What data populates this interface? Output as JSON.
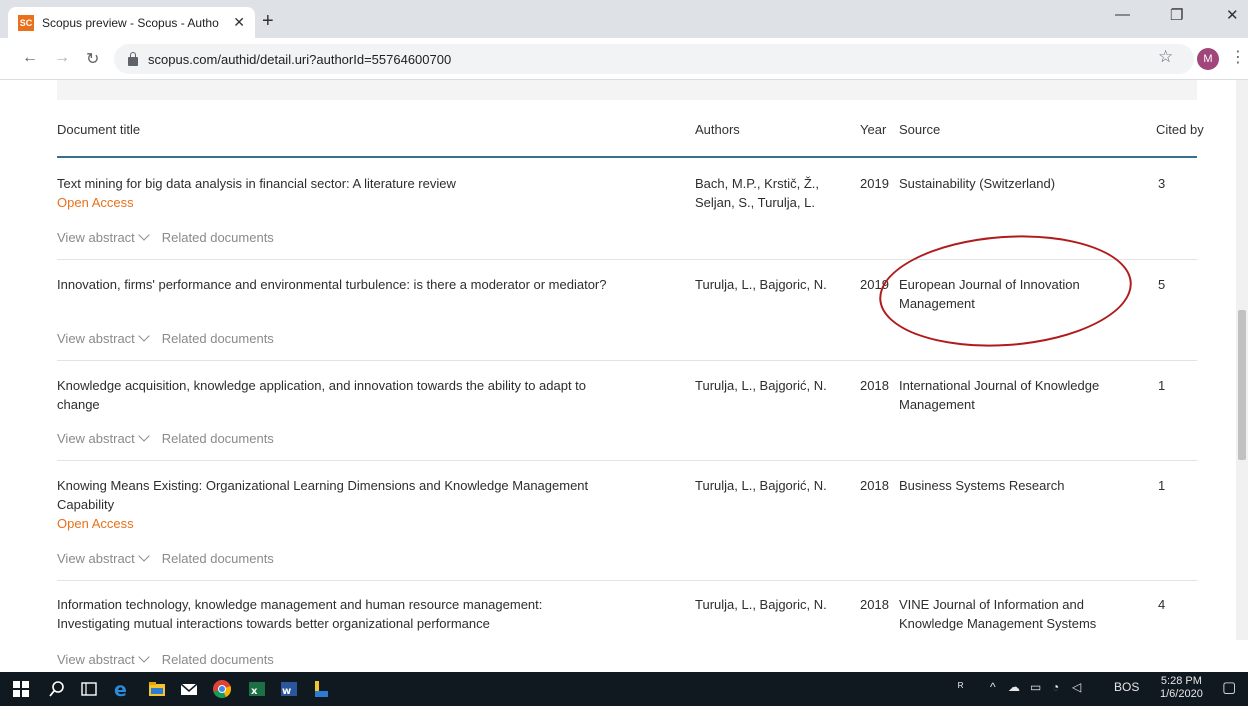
{
  "browser": {
    "tab_title": "Scopus preview - Scopus - Autho",
    "favicon_text": "SC",
    "url": "scopus.com/authid/detail.uri?authorId=55764600700",
    "profile_initial": "M"
  },
  "table": {
    "headers": {
      "title": "Document title",
      "authors": "Authors",
      "year": "Year",
      "source": "Source",
      "cited": "Cited by"
    },
    "actions": {
      "view_abstract": "View abstract",
      "related": "Related documents"
    },
    "rows": [
      {
        "title": "Text mining for big data analysis in financial sector: A literature review",
        "open_access": "Open Access",
        "authors_line1": "Bach, M.P., Krstič, Ž.,",
        "authors_line2": "Seljan, S., Turulja, L.",
        "year": "2019",
        "source_line1": "Sustainability (Switzerland)",
        "source_line2": "",
        "cited": "3"
      },
      {
        "title": "Innovation, firms' performance and environmental turbulence: is there a moderator or mediator?",
        "authors_line1": "Turulja, L., Bajgoric, N.",
        "year": "2019",
        "source_line1": "European Journal of Innovation",
        "source_line2": "Management",
        "cited": "5"
      },
      {
        "title_line1": "Knowledge acquisition, knowledge application, and innovation towards the ability to adapt to",
        "title_line2": "change",
        "authors_line1": "Turulja, L., Bajgorić, N.",
        "year": "2018",
        "source_line1": "International Journal of Knowledge",
        "source_line2": "Management",
        "cited": "1"
      },
      {
        "title_line1": "Knowing Means Existing: Organizational Learning Dimensions and Knowledge Management",
        "title_line2": "Capability",
        "open_access": "Open Access",
        "authors_line1": "Turulja, L., Bajgorić, N.",
        "year": "2018",
        "source_line1": "Business Systems Research",
        "cited": "1"
      },
      {
        "title_line1": "Information technology, knowledge management and human resource management:",
        "title_line2": "Investigating mutual interactions towards better organizational performance",
        "authors_line1": "Turulja, L., Bajgoric, N.",
        "year": "2018",
        "source_line1": "VINE Journal of Information and",
        "source_line2": "Knowledge Management Systems",
        "cited": "4"
      }
    ]
  },
  "taskbar": {
    "language": "BOS",
    "time": "5:28 PM",
    "date": "1/6/2020"
  }
}
